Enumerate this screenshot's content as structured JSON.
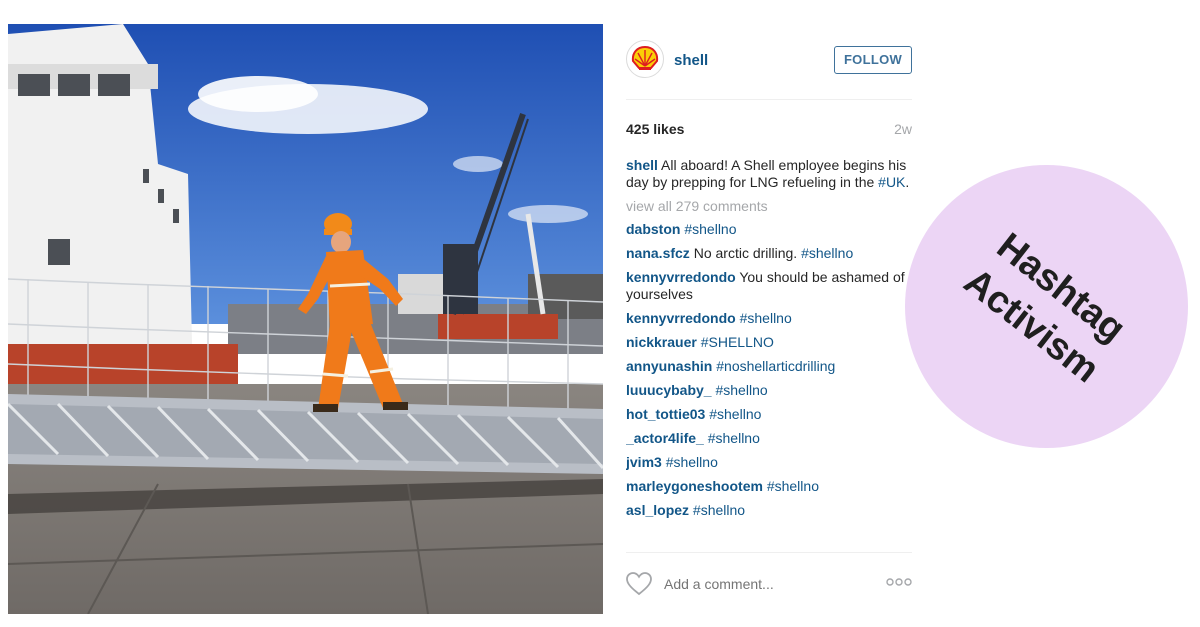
{
  "post": {
    "username": "shell",
    "follow_label": "FOLLOW",
    "likes": "425 likes",
    "time_ago": "2w",
    "caption": {
      "user": "shell",
      "text": "All aboard! A Shell employee begins his day by prepping for LNG refueling in the ",
      "hashtag": "#UK",
      "end": "."
    },
    "view_all": "view all 279 comments",
    "comments": [
      {
        "user": "dabston",
        "text": "",
        "tag": "#shellno"
      },
      {
        "user": "nana.sfcz",
        "text": "No arctic drilling.",
        "tag": "#shellno"
      },
      {
        "user": "kennyvrredondo",
        "text": "You should be ashamed of yourselves",
        "tag": ""
      },
      {
        "user": "kennyvrredondo",
        "text": "",
        "tag": "#shellno"
      },
      {
        "user": "nickkrauer",
        "text": "",
        "tag": "#SHELLNO"
      },
      {
        "user": "annyunashin",
        "text": "",
        "tag": "#noshellarticdrilling"
      },
      {
        "user": "luuucybaby_",
        "text": "",
        "tag": "#shellno"
      },
      {
        "user": "hot_tottie03",
        "text": "",
        "tag": "#shellno"
      },
      {
        "user": "_actor4life_",
        "text": "",
        "tag": "#shellno"
      },
      {
        "user": "jvim3",
        "text": "",
        "tag": "#shellno"
      },
      {
        "user": "marleygoneshootem",
        "text": "",
        "tag": "#shellno"
      },
      {
        "user": "asl_lopez",
        "text": "",
        "tag": "#shellno"
      }
    ],
    "add_comment_placeholder": "Add a comment..."
  },
  "badge": {
    "line1": "Hashtag",
    "line2": "Activism",
    "color": "#ecd5f5"
  },
  "icons": {
    "avatar": "shell-logo-icon",
    "like": "heart-icon",
    "more": "more-options-icon"
  },
  "colors": {
    "link": "#125688",
    "follow": "#3f729b",
    "muted": "#a5a7aa",
    "shell_red": "#dd1d21",
    "shell_yellow": "#fbce07"
  }
}
